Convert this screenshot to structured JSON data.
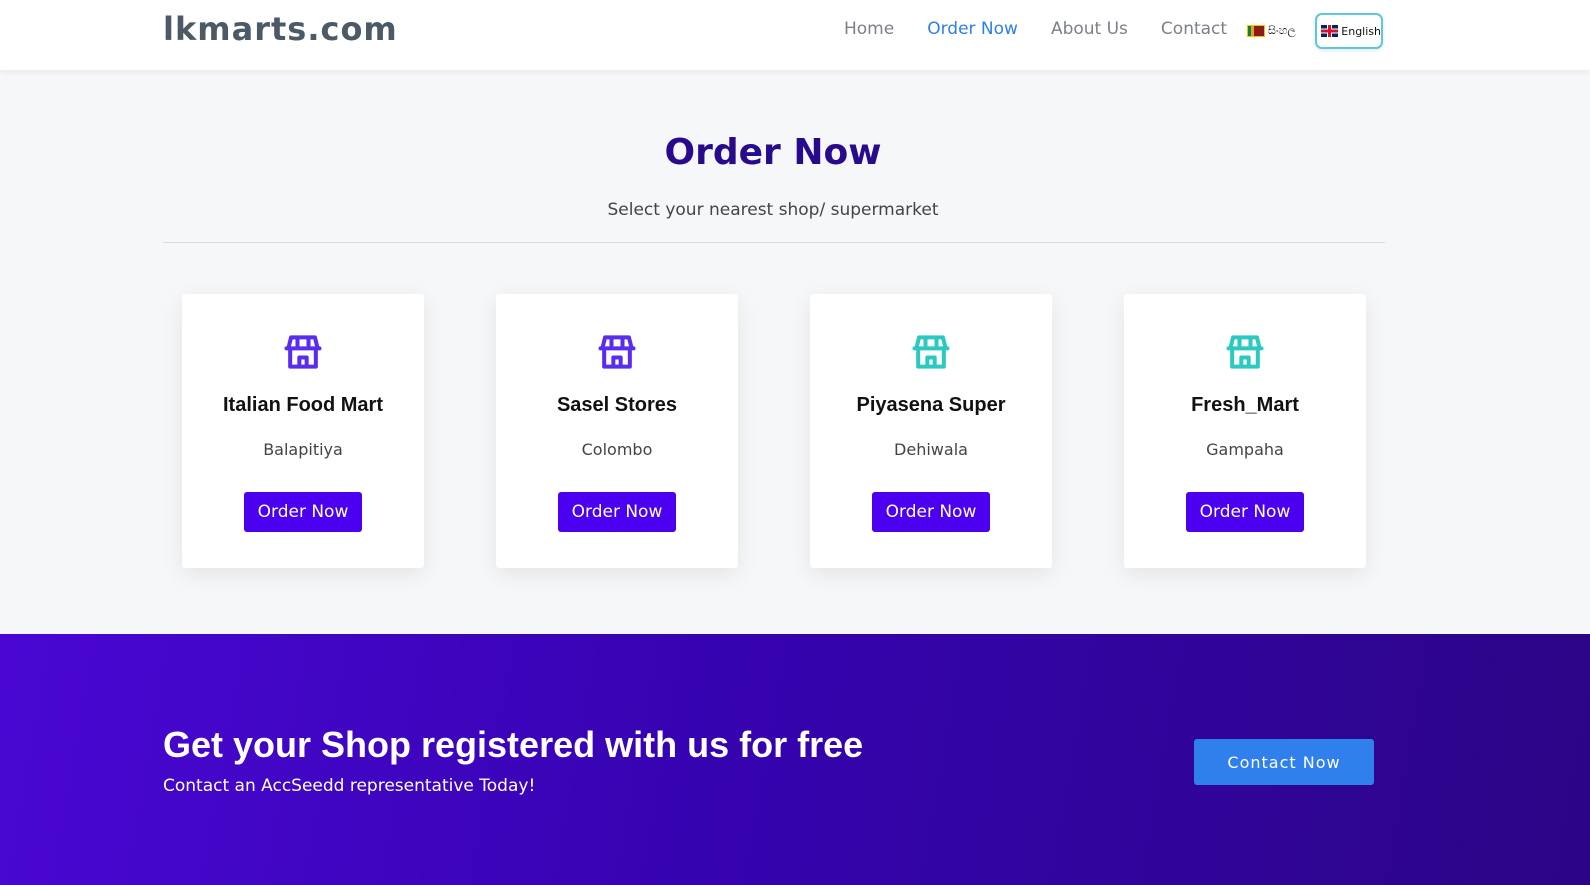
{
  "header": {
    "logo": "lkmarts.com",
    "nav": [
      "Home",
      "Order Now",
      "About Us",
      "Contact"
    ],
    "active_nav": "Order Now",
    "lang_sinhala": "සිංහල",
    "lang_english": "English"
  },
  "main": {
    "title": "Order Now",
    "subtitle": "Select your nearest shop/ supermarket",
    "shops": [
      {
        "name": "Italian Food Mart",
        "city": "Balapitiya",
        "button": "Order Now",
        "icon": "store-icon",
        "icon_color": "#5a2cf0"
      },
      {
        "name": "Sasel Stores",
        "city": "Colombo",
        "button": "Order Now",
        "icon": "store-icon",
        "icon_color": "#5a2cf0"
      },
      {
        "name": "Piyasena Super",
        "city": "Dehiwala",
        "button": "Order Now",
        "icon": "store-icon",
        "icon_color": "#2cc9c2"
      },
      {
        "name": "Fresh_Mart",
        "city": "Gampaha",
        "button": "Order Now",
        "icon": "store-icon",
        "icon_color": "#2cc9c2"
      }
    ]
  },
  "cta": {
    "title": "Get your Shop registered with us for free",
    "subtitle": "Contact an AccSeedd representative Today!",
    "button": "Contact Now"
  },
  "colors": {
    "brand_purple": "#4b00f0",
    "title_purple": "#2a0a8c",
    "link_blue": "#2f7fe0",
    "cta_button": "#2f80ed"
  }
}
